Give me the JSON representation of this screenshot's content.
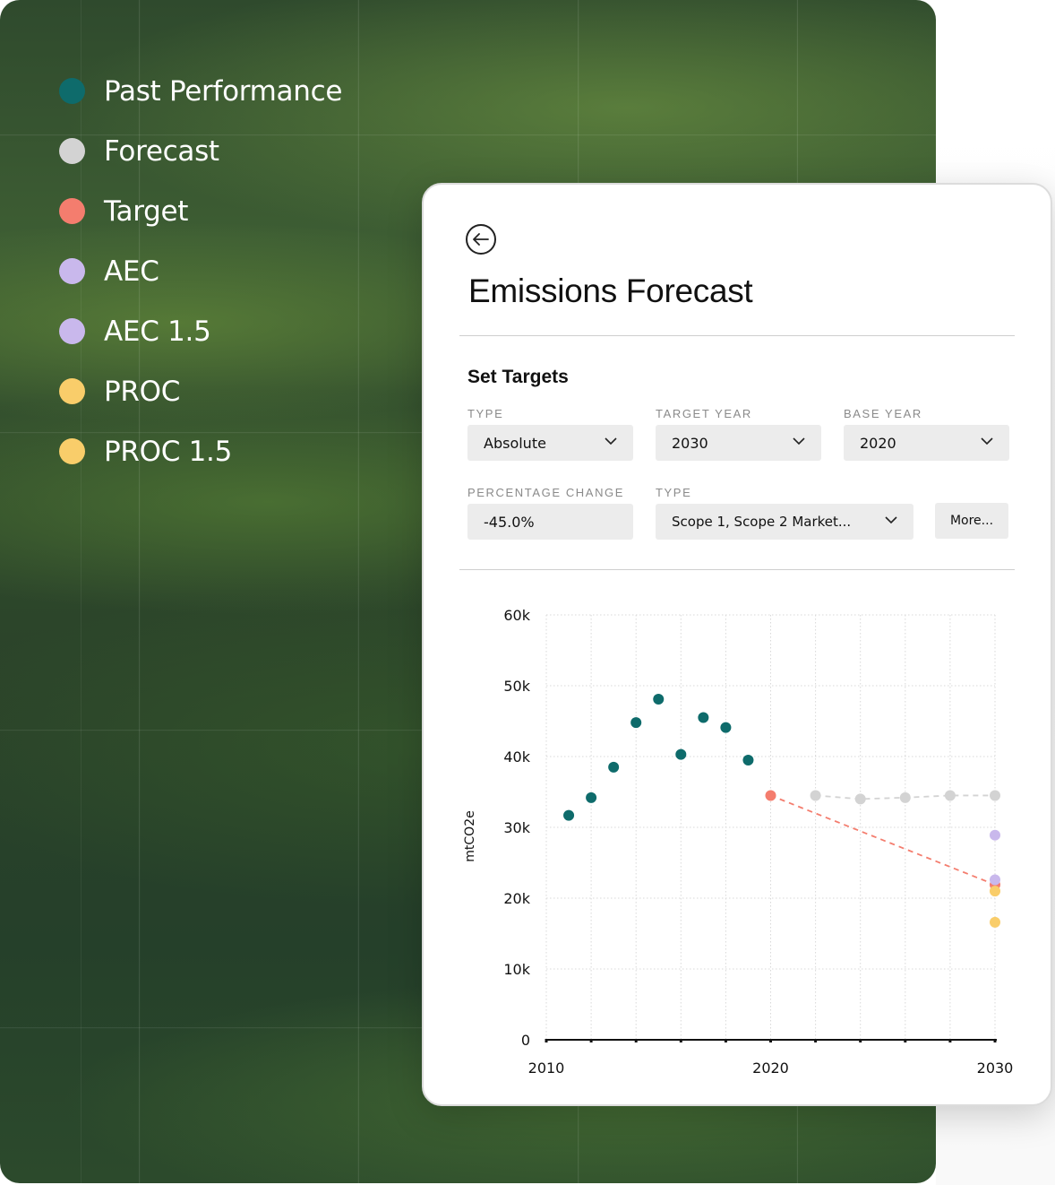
{
  "legend": [
    {
      "label": "Past Performance",
      "color": "#0e6b6b"
    },
    {
      "label": "Forecast",
      "color": "#d3d3d3"
    },
    {
      "label": "Target",
      "color": "#f47d6e"
    },
    {
      "label": "AEC",
      "color": "#c9b8ec"
    },
    {
      "label": "AEC 1.5",
      "color": "#c9b8ec"
    },
    {
      "label": "PROC",
      "color": "#f9cd6a"
    },
    {
      "label": "PROC 1.5",
      "color": "#f9cd6a"
    }
  ],
  "card": {
    "back_icon": "arrow-left-icon",
    "title": "Emissions Forecast",
    "section_title": "Set Targets",
    "fields": {
      "type_label": "TYPE",
      "type_value": "Absolute",
      "target_year_label": "TARGET YEAR",
      "target_year_value": "2030",
      "base_year_label": "BASE YEAR",
      "base_year_value": "2020",
      "percentage_change_label": "PERCENTAGE CHANGE",
      "percentage_change_value": "-45.0%",
      "scope_type_label": "TYPE",
      "scope_type_value": "Scope 1, Scope 2 Market...",
      "more_label": "More..."
    }
  },
  "chart_data": {
    "type": "scatter",
    "ylabel": "mtCO2e",
    "xlabel": "",
    "xlim": [
      2010,
      2030
    ],
    "ylim": [
      0,
      60000
    ],
    "x_ticks": [
      2010,
      2020,
      2030
    ],
    "x_tick_labels": [
      "2010",
      "2020",
      "2030"
    ],
    "y_ticks": [
      0,
      10000,
      20000,
      30000,
      40000,
      50000,
      60000
    ],
    "y_tick_labels": [
      "0",
      "10k",
      "20k",
      "30k",
      "40k",
      "50k",
      "60k"
    ],
    "grid": true,
    "series": [
      {
        "name": "Past Performance",
        "color": "#0e6b6b",
        "line": "none",
        "x": [
          2011,
          2012,
          2013,
          2014,
          2015,
          2016,
          2017,
          2018,
          2019
        ],
        "y": [
          31700,
          34200,
          38500,
          44800,
          48100,
          40300,
          45500,
          44100,
          39500
        ]
      },
      {
        "name": "Forecast",
        "color": "#d3d3d3",
        "line": "dashed",
        "x": [
          2022,
          2024,
          2026,
          2028,
          2030
        ],
        "y": [
          34500,
          34000,
          34200,
          34500,
          34500
        ]
      },
      {
        "name": "Target",
        "color": "#f47d6e",
        "line": "dashed",
        "x": [
          2020,
          2030
        ],
        "y": [
          34500,
          21900
        ]
      },
      {
        "name": "AEC",
        "color": "#c9b8ec",
        "line": "none",
        "x": [
          2030
        ],
        "y": [
          28900
        ]
      },
      {
        "name": "AEC 1.5",
        "color": "#c9b8ec",
        "line": "none",
        "x": [
          2030
        ],
        "y": [
          22600
        ]
      },
      {
        "name": "PROC",
        "color": "#f9cd6a",
        "line": "none",
        "x": [
          2030
        ],
        "y": [
          21000
        ]
      },
      {
        "name": "PROC 1.5",
        "color": "#f9cd6a",
        "line": "none",
        "x": [
          2030
        ],
        "y": [
          16600
        ]
      }
    ]
  }
}
